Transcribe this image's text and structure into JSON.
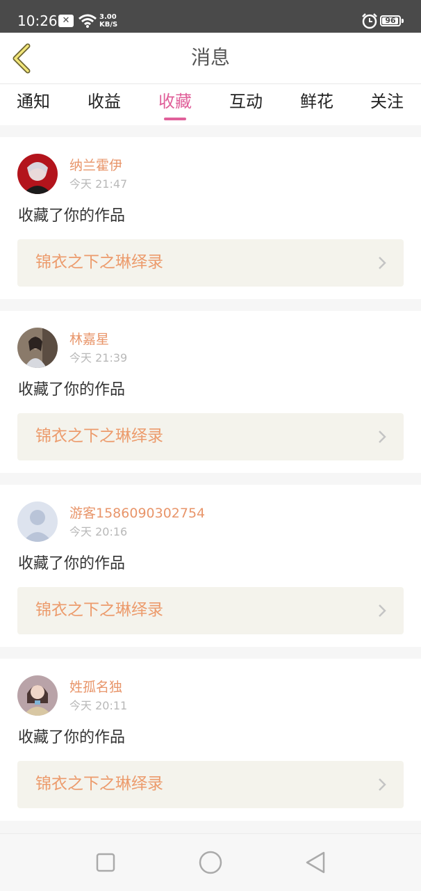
{
  "status_bar": {
    "time": "10:26",
    "notification_icon": "x-box-icon",
    "net_speed_value": "3.00",
    "net_speed_unit": "KB/S",
    "battery": "96",
    "battery_level": 0.96
  },
  "header": {
    "title": "消息",
    "back_icon": "chevron-left-icon"
  },
  "tabs": [
    {
      "label": "通知",
      "active": false
    },
    {
      "label": "收益",
      "active": false
    },
    {
      "label": "收藏",
      "active": true
    },
    {
      "label": "互动",
      "active": false
    },
    {
      "label": "鲜花",
      "active": false
    },
    {
      "label": "关注",
      "active": false
    }
  ],
  "messages": [
    {
      "user": "纳兰霍伊",
      "time": "今天 21:47",
      "action": "收藏了你的作品",
      "work": "锦衣之下之琳绎录",
      "avatar": "avatar-photo-red"
    },
    {
      "user": "林嘉星",
      "time": "今天 21:39",
      "action": "收藏了你的作品",
      "work": "锦衣之下之琳绎录",
      "avatar": "avatar-photo-girl"
    },
    {
      "user": "游客1586090302754",
      "time": "今天 20:16",
      "action": "收藏了你的作品",
      "work": "锦衣之下之琳绎录",
      "avatar": "avatar-default"
    },
    {
      "user": "姓孤名独",
      "time": "今天 20:11",
      "action": "收藏了你的作品",
      "work": "锦衣之下之琳绎录",
      "avatar": "avatar-photo-woman"
    }
  ],
  "nav_bar": {
    "recent_icon": "square-icon",
    "home_icon": "circle-icon",
    "back_icon": "triangle-back-icon"
  },
  "colors": {
    "accent": "#e0609a",
    "username": "#e8956a",
    "work_title": "#ec9b6c",
    "status_bar": "#4a4a4a",
    "link_bg": "#f4f3ec"
  }
}
